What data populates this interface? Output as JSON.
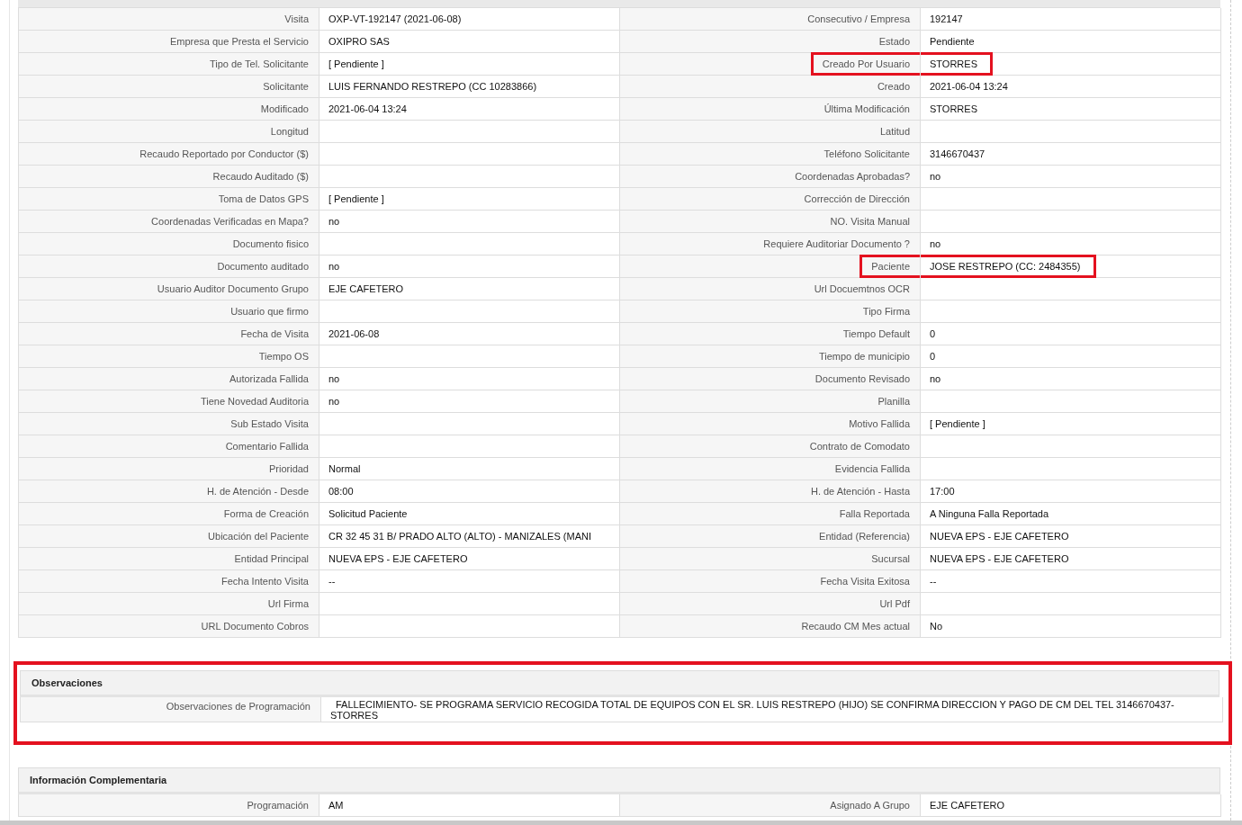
{
  "sections": [
    {
      "highlighted": false,
      "rows": [
        {
          "left": {
            "label": "Visita",
            "value": "OXP-VT-192147 (2021-06-08)",
            "highlighted": false
          },
          "right": {
            "label": "Consecutivo / Empresa",
            "value": "192147",
            "highlighted": false
          }
        },
        {
          "left": {
            "label": "Empresa que Presta el Servicio",
            "value": "OXIPRO SAS",
            "highlighted": false
          },
          "right": {
            "label": "Estado",
            "value": "Pendiente",
            "highlighted": false
          }
        },
        {
          "left": {
            "label": "Tipo de Tel. Solicitante",
            "value": "[ Pendiente ]",
            "highlighted": false
          },
          "right": {
            "label": "Creado Por Usuario",
            "value": "STORRES",
            "highlighted": true
          }
        },
        {
          "left": {
            "label": "Solicitante",
            "value": "LUIS FERNANDO RESTREPO (CC 10283866)",
            "highlighted": false
          },
          "right": {
            "label": "Creado",
            "value": "2021-06-04 13:24",
            "highlighted": false
          }
        },
        {
          "left": {
            "label": "Modificado",
            "value": "2021-06-04 13:24",
            "highlighted": false
          },
          "right": {
            "label": "Última Modificación",
            "value": "STORRES",
            "highlighted": false
          }
        },
        {
          "left": {
            "label": "Longitud",
            "highlighted": false
          },
          "right": {
            "label": "Latitud",
            "highlighted": false
          }
        },
        {
          "left": {
            "label": "Recaudo Reportado por Conductor ($)",
            "highlighted": false
          },
          "right": {
            "label": "Teléfono Solicitante",
            "value": "3146670437",
            "highlighted": false
          }
        },
        {
          "left": {
            "label": "Recaudo Auditado ($)",
            "highlighted": false
          },
          "right": {
            "label": "Coordenadas Aprobadas?",
            "value": "no",
            "highlighted": false
          }
        },
        {
          "left": {
            "label": "Toma de Datos GPS",
            "value": "[ Pendiente ]",
            "highlighted": false
          },
          "right": {
            "label": "Corrección de Dirección",
            "highlighted": false
          }
        },
        {
          "left": {
            "label": "Coordenadas Verificadas en Mapa?",
            "value": "no",
            "highlighted": false
          },
          "right": {
            "label": "NO. Visita Manual",
            "highlighted": false
          }
        },
        {
          "left": {
            "label": "Documento fisico",
            "highlighted": false
          },
          "right": {
            "label": "Requiere Auditoriar Documento ?",
            "value": "no",
            "highlighted": false
          }
        },
        {
          "left": {
            "label": "Documento auditado",
            "value": "no",
            "highlighted": false
          },
          "right": {
            "label": "Paciente",
            "value": "JOSE RESTREPO (CC: 2484355)",
            "highlighted": true
          }
        },
        {
          "left": {
            "label": "Usuario Auditor Documento Grupo",
            "value": "EJE CAFETERO",
            "highlighted": false
          },
          "right": {
            "label": "Url Docuemtnos OCR",
            "highlighted": false
          }
        },
        {
          "left": {
            "label": "Usuario que firmo",
            "highlighted": false
          },
          "right": {
            "label": "Tipo Firma",
            "highlighted": false
          }
        },
        {
          "left": {
            "label": "Fecha de Visita",
            "value": "2021-06-08",
            "highlighted": false
          },
          "right": {
            "label": "Tiempo Default",
            "value": "0",
            "highlighted": false
          }
        },
        {
          "left": {
            "label": "Tiempo OS",
            "highlighted": false
          },
          "right": {
            "label": "Tiempo de municipio",
            "value": "0",
            "highlighted": false
          }
        },
        {
          "left": {
            "label": "Autorizada Fallida",
            "value": "no",
            "highlighted": false
          },
          "right": {
            "label": "Documento Revisado",
            "value": "no",
            "highlighted": false
          }
        },
        {
          "left": {
            "label": "Tiene Novedad Auditoria",
            "value": "no",
            "highlighted": false
          },
          "right": {
            "label": "Planilla",
            "highlighted": false
          }
        },
        {
          "left": {
            "label": "Sub Estado Visita",
            "highlighted": false
          },
          "right": {
            "label": "Motivo Fallida",
            "value": "[ Pendiente ]",
            "highlighted": false
          }
        },
        {
          "left": {
            "label": "Comentario Fallida",
            "highlighted": false
          },
          "right": {
            "label": "Contrato de Comodato",
            "highlighted": false
          }
        },
        {
          "left": {
            "label": "Prioridad",
            "value": "Normal",
            "highlighted": false
          },
          "right": {
            "label": "Evidencia Fallida",
            "highlighted": false
          }
        },
        {
          "left": {
            "label": "H. de Atención - Desde",
            "value": "08:00",
            "highlighted": false
          },
          "right": {
            "label": "H. de Atención - Hasta",
            "value": "17:00",
            "highlighted": false
          }
        },
        {
          "left": {
            "label": "Forma de Creación",
            "value": "Solicitud Paciente",
            "highlighted": false
          },
          "right": {
            "label": "Falla Reportada",
            "value": "A Ninguna Falla Reportada",
            "highlighted": false
          }
        },
        {
          "left": {
            "label": "Ubicación del Paciente",
            "value": "CR 32 45 31 B/ PRADO ALTO (ALTO) - MANIZALES (MANI",
            "highlighted": false
          },
          "right": {
            "label": "Entidad (Referencia)",
            "value": "NUEVA EPS - EJE CAFETERO",
            "highlighted": false
          }
        },
        {
          "left": {
            "label": "Entidad Principal",
            "value": "NUEVA EPS - EJE CAFETERO",
            "highlighted": false
          },
          "right": {
            "label": "Sucursal",
            "value": "NUEVA EPS - EJE CAFETERO",
            "highlighted": false
          }
        },
        {
          "left": {
            "label": "Fecha Intento Visita",
            "value": "--",
            "highlighted": false
          },
          "right": {
            "label": "Fecha Visita Exitosa",
            "value": "--",
            "highlighted": false
          }
        },
        {
          "left": {
            "label": "Url Firma",
            "highlighted": false
          },
          "right": {
            "label": "Url Pdf",
            "highlighted": false
          }
        },
        {
          "left": {
            "label": "URL Documento Cobros",
            "highlighted": false
          },
          "right": {
            "label": "Recaudo CM Mes actual",
            "value": "No",
            "highlighted": false
          }
        }
      ]
    },
    {
      "title": "Observaciones",
      "highlighted": true,
      "wide_rows": [
        {
          "label": "Observaciones de Programación",
          "value": "FALLECIMIENTO- SE PROGRAMA SERVICIO RECOGIDA TOTAL DE EQUIPOS CON EL SR. LUIS RESTREPO (HIJO) SE CONFIRMA DIRECCION Y PAGO DE CM DEL TEL 3146670437- STORRES"
        }
      ]
    },
    {
      "title": "Información Complementaria",
      "highlighted": false,
      "rows": [
        {
          "left": {
            "label": "Programación",
            "value": "AM",
            "highlighted": false
          },
          "right": {
            "label": "Asignado A Grupo",
            "value": "EJE CAFETERO",
            "highlighted": false
          }
        }
      ]
    }
  ]
}
